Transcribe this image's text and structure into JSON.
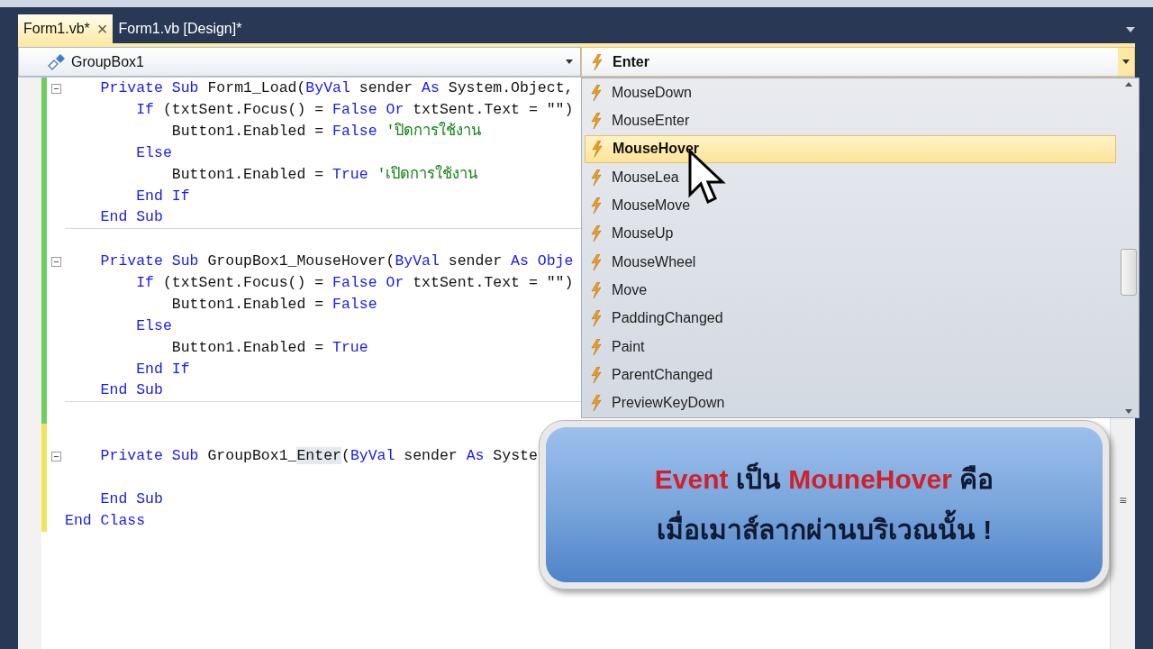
{
  "tabs": [
    {
      "label": "Form1.vb*",
      "selected": true,
      "close": "×"
    },
    {
      "label": "Form1.vb [Design]*",
      "selected": false
    }
  ],
  "nav": {
    "object": "GroupBox1",
    "event": "Enter"
  },
  "code_lines": [
    {
      "modified": false,
      "outline": true,
      "separator": false,
      "tokens": [
        {
          "kind": "kw",
          "text": "    Private Sub "
        },
        {
          "kind": "plain",
          "text": "Form1_Load("
        },
        {
          "kind": "kw",
          "text": "ByVal"
        },
        {
          "kind": "plain",
          "text": " sender "
        },
        {
          "kind": "kw",
          "text": "As"
        },
        {
          "kind": "plain",
          "text": " System.Object,"
        }
      ]
    },
    {
      "modified": false,
      "outline": false,
      "separator": false,
      "tokens": [
        {
          "kind": "kw",
          "text": "        If"
        },
        {
          "kind": "plain",
          "text": " (txtSent.Focus() = "
        },
        {
          "kind": "kw",
          "text": "False Or"
        },
        {
          "kind": "plain",
          "text": " txtSent.Text = \"\")"
        }
      ]
    },
    {
      "modified": false,
      "outline": false,
      "separator": false,
      "tokens": [
        {
          "kind": "plain",
          "text": "            Button1.Enabled = "
        },
        {
          "kind": "kw",
          "text": "False"
        },
        {
          "kind": "comment",
          "text": " 'ปิดการใช้งาน"
        }
      ]
    },
    {
      "modified": false,
      "outline": false,
      "separator": false,
      "tokens": [
        {
          "kind": "kw",
          "text": "        Else"
        }
      ]
    },
    {
      "modified": false,
      "outline": false,
      "separator": false,
      "tokens": [
        {
          "kind": "plain",
          "text": "            Button1.Enabled = "
        },
        {
          "kind": "kw",
          "text": "True"
        },
        {
          "kind": "comment",
          "text": " 'เปิดการใช้งาน"
        }
      ]
    },
    {
      "modified": false,
      "outline": false,
      "separator": false,
      "tokens": [
        {
          "kind": "kw",
          "text": "        End If"
        }
      ]
    },
    {
      "modified": false,
      "outline": false,
      "separator": true,
      "tokens": [
        {
          "kind": "kw",
          "text": "    End Sub"
        }
      ]
    },
    {
      "modified": false,
      "outline": false,
      "separator": false
    },
    {
      "modified": false,
      "outline": true,
      "separator": false,
      "tokens": [
        {
          "kind": "kw",
          "text": "    Private Sub "
        },
        {
          "kind": "plain",
          "text": "GroupBox1_MouseHover("
        },
        {
          "kind": "kw",
          "text": "ByVal"
        },
        {
          "kind": "plain",
          "text": " sender "
        },
        {
          "kind": "kw",
          "text": "As Obje"
        }
      ]
    },
    {
      "modified": false,
      "outline": false,
      "separator": false,
      "tokens": [
        {
          "kind": "kw",
          "text": "        If"
        },
        {
          "kind": "plain",
          "text": " (txtSent.Focus() = "
        },
        {
          "kind": "kw",
          "text": "False Or"
        },
        {
          "kind": "plain",
          "text": " txtSent.Text = \"\")"
        }
      ]
    },
    {
      "modified": false,
      "outline": false,
      "separator": false,
      "tokens": [
        {
          "kind": "plain",
          "text": "            Button1.Enabled = "
        },
        {
          "kind": "kw",
          "text": "False"
        }
      ]
    },
    {
      "modified": false,
      "outline": false,
      "separator": false,
      "tokens": [
        {
          "kind": "kw",
          "text": "        Else"
        }
      ]
    },
    {
      "modified": false,
      "outline": false,
      "separator": false,
      "tokens": [
        {
          "kind": "plain",
          "text": "            Button1.Enabled = "
        },
        {
          "kind": "kw",
          "text": "True"
        }
      ]
    },
    {
      "modified": false,
      "outline": false,
      "separator": false,
      "tokens": [
        {
          "kind": "kw",
          "text": "        End If"
        }
      ]
    },
    {
      "modified": false,
      "outline": false,
      "separator": true,
      "tokens": [
        {
          "kind": "kw",
          "text": "    End Sub"
        }
      ]
    },
    {
      "modified": false,
      "outline": false,
      "separator": false
    },
    {
      "modified": true,
      "outline": false,
      "separator": false
    },
    {
      "modified": true,
      "outline": true,
      "separator": false,
      "tokens": [
        {
          "kind": "kw",
          "text": "    Private Sub "
        },
        {
          "kind": "plain",
          "text": "GroupBox1_"
        },
        {
          "kind": "ref",
          "text": "Enter"
        },
        {
          "kind": "plain",
          "text": "("
        },
        {
          "kind": "kw",
          "text": "ByVal"
        },
        {
          "kind": "plain",
          "text": " sender "
        },
        {
          "kind": "kw",
          "text": "As"
        },
        {
          "kind": "plain",
          "text": " Syste"
        }
      ]
    },
    {
      "modified": true,
      "outline": false,
      "separator": false
    },
    {
      "modified": true,
      "outline": false,
      "separator": false,
      "tokens": [
        {
          "kind": "kw",
          "text": "    End Sub"
        }
      ]
    },
    {
      "modified": true,
      "outline": false,
      "separator": false,
      "tokens": [
        {
          "kind": "kw",
          "text": "End Class"
        }
      ]
    }
  ],
  "split_handle": "≡",
  "event_list": [
    {
      "label": "MouseDown",
      "selected": false
    },
    {
      "label": "MouseEnter",
      "selected": false
    },
    {
      "label": "MouseHover",
      "selected": true
    },
    {
      "label": "MouseLea",
      "selected": false
    },
    {
      "label": "MouseMove",
      "selected": false
    },
    {
      "label": "MouseUp",
      "selected": false
    },
    {
      "label": "MouseWheel",
      "selected": false
    },
    {
      "label": "Move",
      "selected": false
    },
    {
      "label": "PaddingChanged",
      "selected": false
    },
    {
      "label": "Paint",
      "selected": false
    },
    {
      "label": "ParentChanged",
      "selected": false
    },
    {
      "label": "PreviewKeyDown",
      "selected": false
    }
  ],
  "caption": {
    "lines": [
      [
        {
          "text": "Event",
          "highlight": true
        },
        {
          "text": " เป็น ",
          "highlight": false
        },
        {
          "text": "MouneHover",
          "highlight": true
        },
        {
          "text": " คือ",
          "highlight": false
        }
      ],
      [
        {
          "text": "เมื่อเมาส์ลากผ่านบริเวณนั้น !",
          "highlight": false
        }
      ]
    ]
  }
}
